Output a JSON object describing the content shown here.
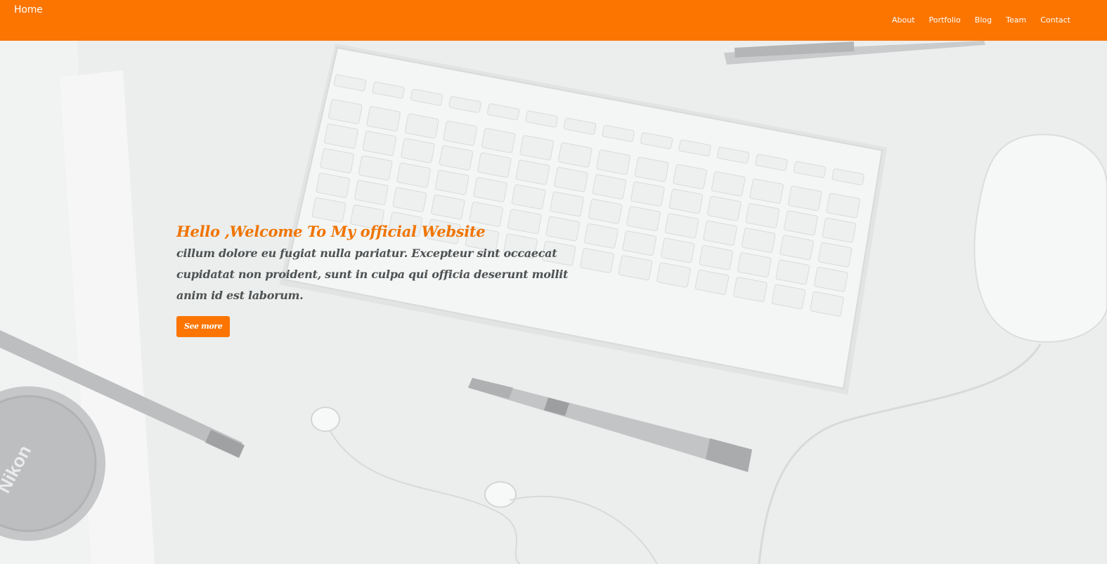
{
  "navbar": {
    "brand": "Home",
    "links": [
      {
        "label": "About"
      },
      {
        "label": "Portfolio"
      },
      {
        "label": "Blog"
      },
      {
        "label": "Team"
      },
      {
        "label": "Contact"
      }
    ],
    "background_color": "#fb7500"
  },
  "hero": {
    "title": "Hello ,Welcome To My official Website",
    "text": "cillum dolore eu fugiat nulla pariatur. Excepteur sint occaecat cupidatat non proident, sunt in culpa qui officia deserunt mollit anim id est laborum.",
    "button_label": "See more",
    "accent_color": "#fb7500",
    "background_lens_cap_text": "Nikon"
  }
}
